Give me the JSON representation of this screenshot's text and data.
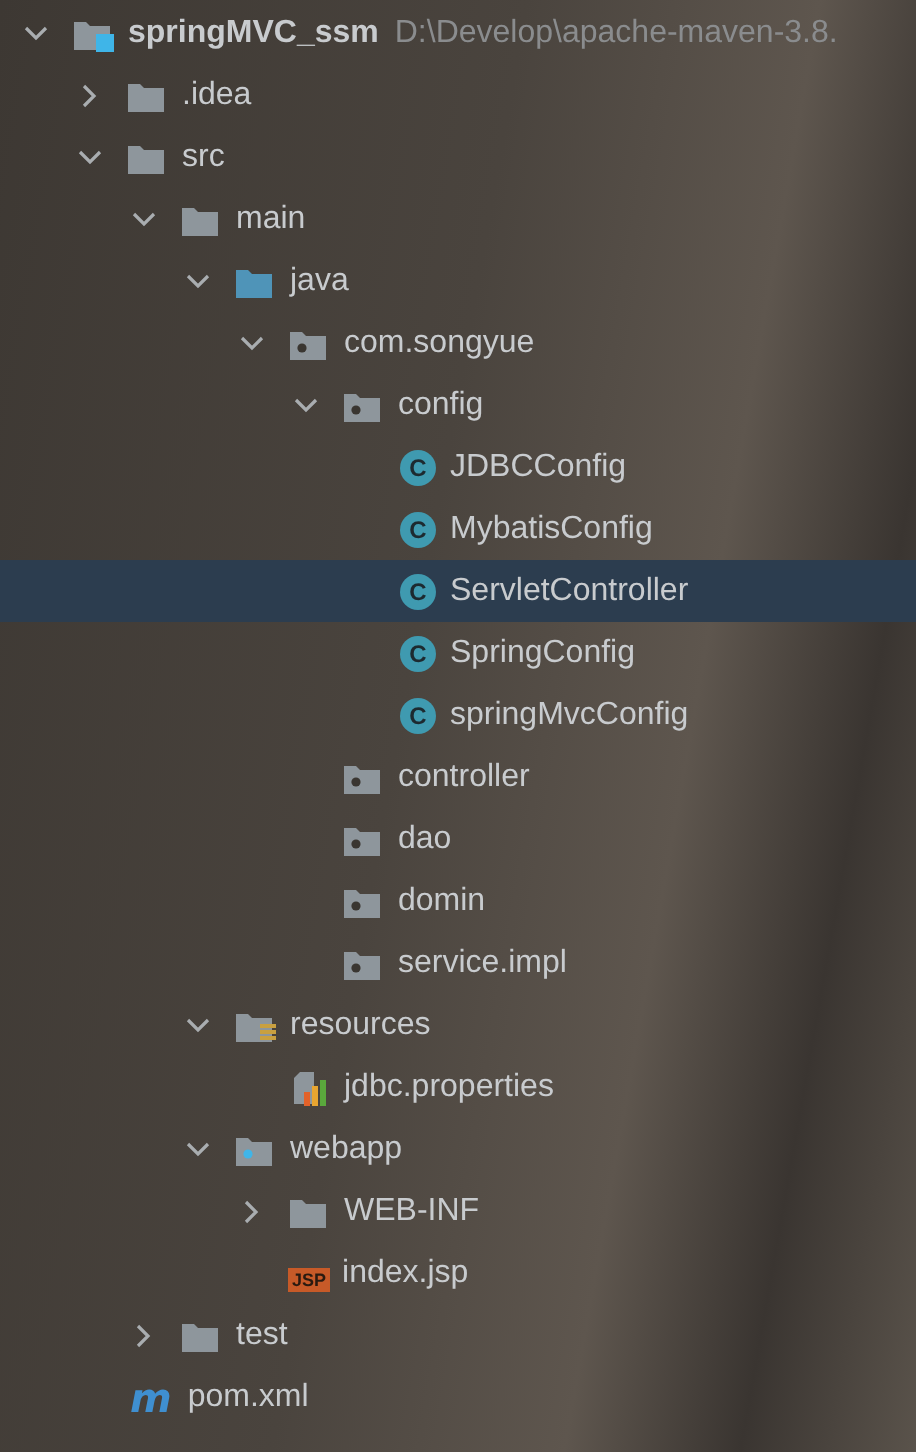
{
  "tree": [
    {
      "label": "springMVC_ssm",
      "hint": "D:\\Develop\\apache-maven-3.8.",
      "kind": "module",
      "expanded": true,
      "selected": false,
      "children": [
        {
          "label": ".idea",
          "kind": "folder",
          "expanded": false,
          "selected": false
        },
        {
          "label": "src",
          "kind": "folder",
          "expanded": true,
          "selected": false,
          "children": [
            {
              "label": "main",
              "kind": "folder",
              "expanded": true,
              "selected": false,
              "children": [
                {
                  "label": "java",
                  "kind": "source",
                  "expanded": true,
                  "selected": false,
                  "children": [
                    {
                      "label": "com.songyue",
                      "kind": "package",
                      "expanded": true,
                      "selected": false,
                      "children": [
                        {
                          "label": "config",
                          "kind": "package",
                          "expanded": true,
                          "selected": false,
                          "children": [
                            {
                              "label": "JDBCConfig",
                              "kind": "class",
                              "badge": "C",
                              "selected": false
                            },
                            {
                              "label": "MybatisConfig",
                              "kind": "class",
                              "badge": "C",
                              "selected": false
                            },
                            {
                              "label": "ServletController",
                              "kind": "class",
                              "badge": "C",
                              "selected": true
                            },
                            {
                              "label": "SpringConfig",
                              "kind": "class",
                              "badge": "C",
                              "selected": false
                            },
                            {
                              "label": "springMvcConfig",
                              "kind": "class",
                              "badge": "C",
                              "selected": false
                            }
                          ]
                        },
                        {
                          "label": "controller",
                          "kind": "package",
                          "selected": false
                        },
                        {
                          "label": "dao",
                          "kind": "package",
                          "selected": false
                        },
                        {
                          "label": "domin",
                          "kind": "package",
                          "selected": false
                        },
                        {
                          "label": "service.impl",
                          "kind": "package",
                          "selected": false
                        }
                      ]
                    }
                  ]
                },
                {
                  "label": "resources",
                  "kind": "resources",
                  "expanded": true,
                  "selected": false,
                  "children": [
                    {
                      "label": "jdbc.properties",
                      "kind": "properties",
                      "selected": false
                    }
                  ]
                },
                {
                  "label": "webapp",
                  "kind": "webapp",
                  "expanded": true,
                  "selected": false,
                  "children": [
                    {
                      "label": "WEB-INF",
                      "kind": "folder",
                      "expanded": false,
                      "selected": false
                    },
                    {
                      "label": "index.jsp",
                      "kind": "jsp",
                      "badge": "JSP",
                      "selected": false
                    }
                  ]
                }
              ]
            },
            {
              "label": "test",
              "kind": "folder",
              "expanded": false,
              "selected": false
            }
          ]
        },
        {
          "label": "pom.xml",
          "kind": "maven",
          "badge": "m",
          "selected": false
        }
      ]
    }
  ]
}
